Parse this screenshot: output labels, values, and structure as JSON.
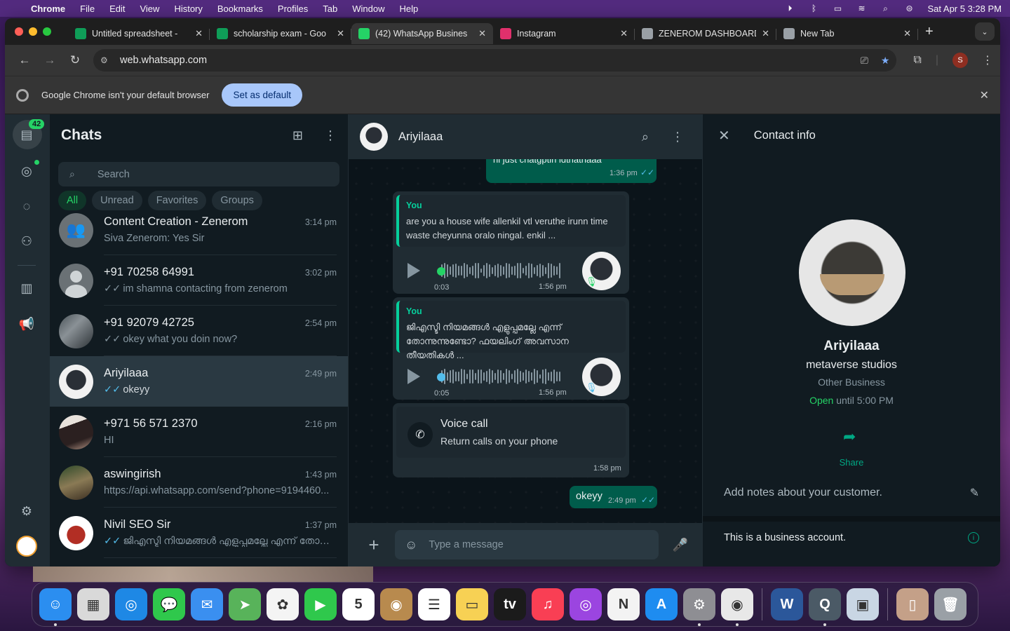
{
  "menubar": {
    "app": "Chrome",
    "items": [
      "File",
      "Edit",
      "View",
      "History",
      "Bookmarks",
      "Profiles",
      "Tab",
      "Window",
      "Help"
    ],
    "clock": "Sat Apr 5  3:28 PM"
  },
  "tabs": [
    {
      "label": "Untitled spreadsheet - ",
      "favicon_color": "#0f9d58",
      "active": false
    },
    {
      "label": "scholarship exam - Goo",
      "favicon_color": "#0f9d58",
      "active": false
    },
    {
      "label": "(42) WhatsApp Busines",
      "favicon_color": "#25d366",
      "active": true
    },
    {
      "label": "Instagram",
      "favicon_color": "#e1306c",
      "active": false
    },
    {
      "label": "ZENEROM DASHBOARD",
      "favicon_color": "#9aa0a6",
      "active": false
    },
    {
      "label": "New Tab",
      "favicon_color": "#9aa0a6",
      "active": false
    }
  ],
  "toolbar": {
    "url": "web.whatsapp.com",
    "profile_initial": "S"
  },
  "infobar": {
    "message": "Google Chrome isn't your default browser",
    "button": "Set as default"
  },
  "rail": {
    "unread_badge": "42"
  },
  "chatlist": {
    "title": "Chats",
    "search_placeholder": "Search",
    "filters": [
      "All",
      "Unread",
      "Favorites",
      "Groups"
    ],
    "chats": [
      {
        "name": "Content Creation - Zenerom",
        "time": "3:14 pm",
        "preview": "Siva Zenerom: Yes Sir",
        "tick": ""
      },
      {
        "name": "+91 70258 64991",
        "time": "3:02 pm",
        "preview": "im shamna contacting from zenerom",
        "tick": "grey"
      },
      {
        "name": "+91 92079 42725",
        "time": "2:54 pm",
        "preview": "okey what you doin now?",
        "tick": "grey"
      },
      {
        "name": "Ariyilaaa",
        "time": "2:49 pm",
        "preview": "okeyy",
        "tick": "blue"
      },
      {
        "name": "+971 56 571 2370",
        "time": "2:16 pm",
        "preview": "HI",
        "tick": ""
      },
      {
        "name": "aswingirish",
        "time": "1:43 pm",
        "preview": "https://api.whatsapp.com/send?phone=9194460...",
        "tick": ""
      },
      {
        "name": "Nivil SEO Sir",
        "time": "1:37 pm",
        "preview": "ജിഎസ്ടി നിയമങ്ങൾ എളുപ്പമല്ലേ എന്ന് തോന്നു...",
        "tick": "blue"
      }
    ]
  },
  "conversation": {
    "contact_name": "Ariyilaaa",
    "top_snippet": "hi just chatgptin ldthathaaa",
    "top_snippet_time": "1:36 pm",
    "voice1": {
      "quote_sender": "You",
      "quote_text": "are you a house wife allenkil vtl veruthe irunn time waste cheyunna oralo ningal. enkil ...",
      "duration": "0:03",
      "time": "1:56 pm",
      "progress_color": "#25d366"
    },
    "voice2": {
      "quote_sender": "You",
      "quote_text": "ജിഎസ്ടി നിയമങ്ങൾ എളുപ്പമല്ലേ എന്ന് തോന്നുന്നുണ്ടോ? ഫയലിംഗ് അവസാന തീയതികൾ ...",
      "duration": "0:05",
      "time": "1:56 pm",
      "progress_color": "#53bdeb"
    },
    "call": {
      "title": "Voice call",
      "subtitle": "Return calls on your phone",
      "time": "1:58 pm"
    },
    "last_msg": {
      "text": "okeyy",
      "time": "2:49 pm"
    },
    "composer_placeholder": "Type a message"
  },
  "contact_info": {
    "header": "Contact info",
    "name": "Ariyilaaa",
    "business_name": "metaverse studios",
    "category": "Other Business",
    "open_label": "Open",
    "hours": "until 5:00 PM",
    "share_label": "Share",
    "notes_placeholder": "Add notes about your customer.",
    "business_note": "This is a business account."
  },
  "dock": {
    "apps": [
      {
        "name": "finder",
        "color": "#2b8ef0",
        "glyph": "☺"
      },
      {
        "name": "launchpad",
        "color": "#d9d9d9",
        "glyph": "▦"
      },
      {
        "name": "safari",
        "color": "#1e88e5",
        "glyph": "◎"
      },
      {
        "name": "messages",
        "color": "#2fc84c",
        "glyph": "💬"
      },
      {
        "name": "mail",
        "color": "#3a8ff0",
        "glyph": "✉"
      },
      {
        "name": "maps",
        "color": "#58b35a",
        "glyph": "➤"
      },
      {
        "name": "photos",
        "color": "#f4f4f4",
        "glyph": "✿"
      },
      {
        "name": "facetime",
        "color": "#2fc84c",
        "glyph": "▶"
      },
      {
        "name": "calendar",
        "color": "#ffffff",
        "glyph": "5"
      },
      {
        "name": "contacts",
        "color": "#b88a4e",
        "glyph": "◉"
      },
      {
        "name": "reminders",
        "color": "#ffffff",
        "glyph": "☰"
      },
      {
        "name": "notes",
        "color": "#f7d154",
        "glyph": "▭"
      },
      {
        "name": "tv",
        "color": "#1b1b1b",
        "glyph": "tv"
      },
      {
        "name": "music",
        "color": "#f93f54",
        "glyph": "♫"
      },
      {
        "name": "podcasts",
        "color": "#9b45e0",
        "glyph": "◎"
      },
      {
        "name": "news",
        "color": "#f3f3f3",
        "glyph": "N"
      },
      {
        "name": "app-store",
        "color": "#1e8cf0",
        "glyph": "A"
      },
      {
        "name": "system-settings",
        "color": "#8e8e93",
        "glyph": "⚙"
      },
      {
        "name": "chrome",
        "color": "#e8e8e8",
        "glyph": "◉"
      },
      {
        "name": "word",
        "color": "#2b579a",
        "glyph": "W"
      },
      {
        "name": "quicktime",
        "color": "#4b5a66",
        "glyph": "Q"
      },
      {
        "name": "preview",
        "color": "#c9d6e4",
        "glyph": "▣"
      },
      {
        "name": "downloads-stack",
        "color": "#c4a088",
        "glyph": "▯"
      },
      {
        "name": "trash",
        "color": "#9aa0a6",
        "glyph": "🗑"
      }
    ]
  }
}
